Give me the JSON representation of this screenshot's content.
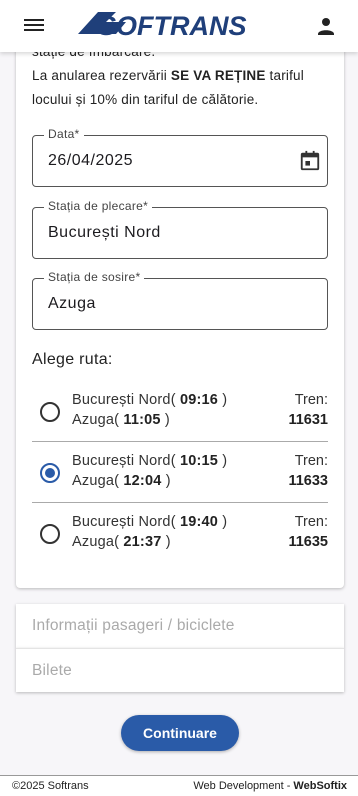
{
  "header": {
    "logo_text": "SOFTRANS"
  },
  "notice": {
    "line1": "stație de îmbarcare.",
    "line2_pre": "La anularea rezervării ",
    "line2_bold": "SE VA REȚINE",
    "line2_post": " tariful",
    "line3": "locului și 10% din tariful de călătorie."
  },
  "form": {
    "date_label": "Data*",
    "date_value": "26/04/2025",
    "departure_label": "Stația de plecare*",
    "departure_value": "București Nord",
    "arrival_label": "Stația de sosire*",
    "arrival_value": "Azuga"
  },
  "routes": {
    "title": "Alege ruta:",
    "items": [
      {
        "from": "București Nord",
        "dep_time": "09:16",
        "to": "Azuga",
        "arr_time": "11:05",
        "train_label": "Tren:",
        "train_no": "11631",
        "selected": false
      },
      {
        "from": "București Nord",
        "dep_time": "10:15",
        "to": "Azuga",
        "arr_time": "12:04",
        "train_label": "Tren:",
        "train_no": "11633",
        "selected": true
      },
      {
        "from": "București Nord",
        "dep_time": "19:40",
        "to": "Azuga",
        "arr_time": "21:37",
        "train_label": "Tren:",
        "train_no": "11635",
        "selected": false
      }
    ]
  },
  "panels": {
    "passengers": "Informații pasageri / biciclete",
    "tickets": "Bilete"
  },
  "actions": {
    "continue_label": "Continuare"
  },
  "footer": {
    "copyright": "©2025 Softrans",
    "dev_prefix": "Web Development - ",
    "dev_name": "WebSoftix"
  },
  "colors": {
    "accent": "#2a5ba8",
    "logo": "#1f3f7a"
  },
  "icons": {
    "menu": "menu-icon",
    "user": "person-icon",
    "calendar": "calendar-icon"
  }
}
